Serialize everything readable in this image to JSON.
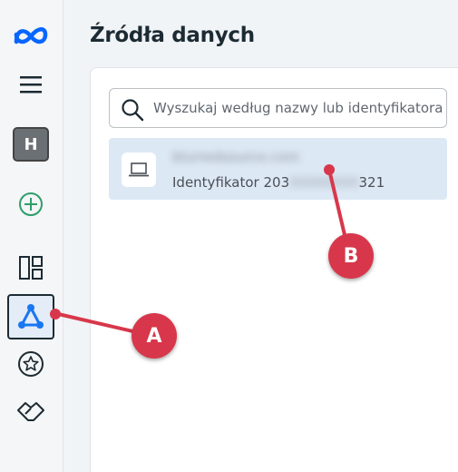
{
  "sidebar": {
    "items": [
      {
        "name": "meta-logo-icon"
      },
      {
        "name": "menu-icon"
      },
      {
        "name": "account-avatar",
        "label": "H"
      },
      {
        "name": "create-icon"
      },
      {
        "name": "overview-icon"
      },
      {
        "name": "data-sources-icon"
      },
      {
        "name": "favorites-icon"
      },
      {
        "name": "partners-icon"
      }
    ]
  },
  "main": {
    "title": "Źródła danych",
    "search": {
      "placeholder": "Wyszukaj według nazwy lub identyfikatora"
    },
    "sources": [
      {
        "name": "blurredsource.com",
        "id_prefix": "Identyfikator 203",
        "id_hidden": "00000000",
        "id_suffix": "321"
      }
    ]
  },
  "annotations": {
    "a": "A",
    "b": "B",
    "color": "#d8374b"
  }
}
